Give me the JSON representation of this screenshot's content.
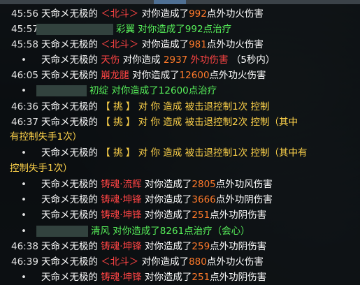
{
  "colors": {
    "white": "#ffffff",
    "red": "#ff4444",
    "yellow": "#ffd34a",
    "green": "#57f05a",
    "number": "#ff7a2a"
  },
  "icons": {
    "bullet": "bullet-dot"
  },
  "lines": [
    {
      "time": "45:56",
      "parts": [
        "天命メ无极的",
        "＜北斗＞",
        "对你造成了",
        "992",
        "点外功火伤害"
      ]
    },
    {
      "time": "45:57",
      "parts": [
        "彩翼",
        "对你造成了992点治疗"
      ]
    },
    {
      "time": "45:58",
      "parts": [
        "天命メ无极的",
        "＜北斗＞",
        "对你造成了",
        "981",
        "点外功火伤害"
      ]
    },
    {
      "bullet": "•",
      "parts": [
        "天命メ无极的",
        "天伤",
        "对你造成",
        "2937",
        "外功伤害",
        "（5秒内）"
      ]
    },
    {
      "time": "46:05",
      "parts": [
        "天命メ无极的",
        "崩龙腿",
        "对你造成了",
        "12600",
        "点外功火伤害"
      ]
    },
    {
      "bullet": "•",
      "parts": [
        "初绽",
        "对你造成了12600点治疗"
      ]
    },
    {
      "time": "46:36",
      "parts": [
        "天命メ无极的",
        "【 挑 】",
        "对",
        "你",
        "造成",
        "被击退控制1次",
        "控制"
      ]
    },
    {
      "time": "46:37",
      "parts": [
        "天命メ无极的",
        "【 挑 】",
        "对",
        "你",
        "造成",
        "被击退控制2次",
        "控制（其中"
      ]
    },
    {
      "wrap": "有控制失手1次）"
    },
    {
      "bullet": "•",
      "parts": [
        "天命メ无极的",
        "【 挑 】",
        "对",
        "你",
        "造成",
        "被击退控制1次",
        "控制（其中有"
      ]
    },
    {
      "wrap": "控制失手1次）"
    },
    {
      "bullet": "•",
      "parts": [
        "天命メ无极的",
        "铸魂·流辉",
        "对你造成了",
        "2805",
        "点外功风伤害"
      ]
    },
    {
      "bullet": "•",
      "parts": [
        "天命メ无极的",
        "铸魂·坤锋",
        "对你造成了",
        "3666",
        "点外功阴伤害"
      ]
    },
    {
      "bullet": "•",
      "parts": [
        "天命メ无极的",
        "铸魂·坤锋",
        "对你造成了",
        "251",
        "点外功阴伤害"
      ]
    },
    {
      "bullet": "•",
      "parts": [
        "清风",
        "对你造成了8261点治疗（会心）"
      ]
    },
    {
      "time": "46:38",
      "parts": [
        "天命メ无极的",
        "铸魂·坤锋",
        "对你造成了",
        "259",
        "点外功阴伤害"
      ]
    },
    {
      "time": "46:39",
      "parts": [
        "天命メ无极的",
        "＜北斗＞",
        "对你造成了",
        "880",
        "点外功火伤害"
      ]
    },
    {
      "bullet": "•",
      "parts": [
        "天命メ无极的",
        "铸魂·坤锋",
        "对你造成了",
        "251",
        "点外功阴伤害"
      ]
    }
  ]
}
